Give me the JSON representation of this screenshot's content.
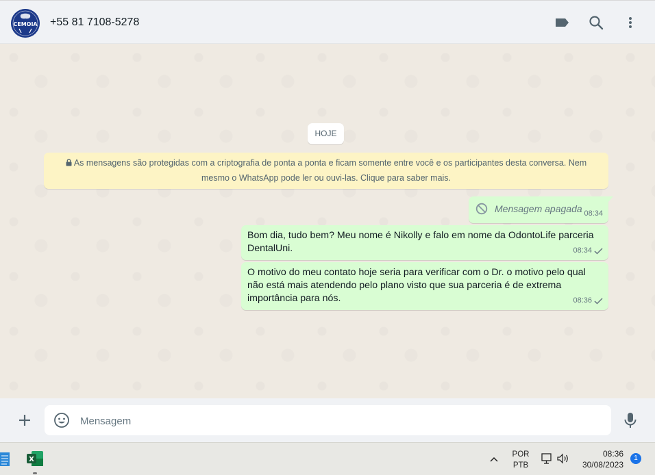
{
  "header": {
    "avatar_text": "CEMOIA",
    "contact_name": "+55 81 7108-5278",
    "icons": [
      "label-icon",
      "search-icon",
      "menu-icon"
    ]
  },
  "chat": {
    "date_chip": "HOJE",
    "encryption_notice": "As mensagens são protegidas com a criptografia de ponta a ponta e ficam somente entre você e os participantes desta conversa. Nem mesmo o WhatsApp pode ler ou ouvi-las. Clique para saber mais.",
    "messages": [
      {
        "text": "Mensagem apagada",
        "time": "08:34",
        "deleted": true
      },
      {
        "text": "Bom dia, tudo bem? Meu nome é Nikolly e falo em nome da OdontoLife parceria DentalUni.",
        "time": "08:34",
        "status": "sent"
      },
      {
        "text": "O motivo do meu contato hoje seria para verificar com o Dr. o motivo pelo qual não está mais atendendo pelo plano visto que sua parceria é de extrema importância para nós.",
        "time": "08:36",
        "status": "sent"
      }
    ],
    "colors": {
      "outgoing_bubble": "#d9fdd3",
      "notice_bg": "#fdf4c5",
      "wallpaper": "#efeae2"
    }
  },
  "composer": {
    "placeholder": "Mensagem"
  },
  "taskbar": {
    "lang_line1": "POR",
    "lang_line2": "PTB",
    "time": "08:36",
    "date": "30/08/2023",
    "notification_count": "1"
  }
}
